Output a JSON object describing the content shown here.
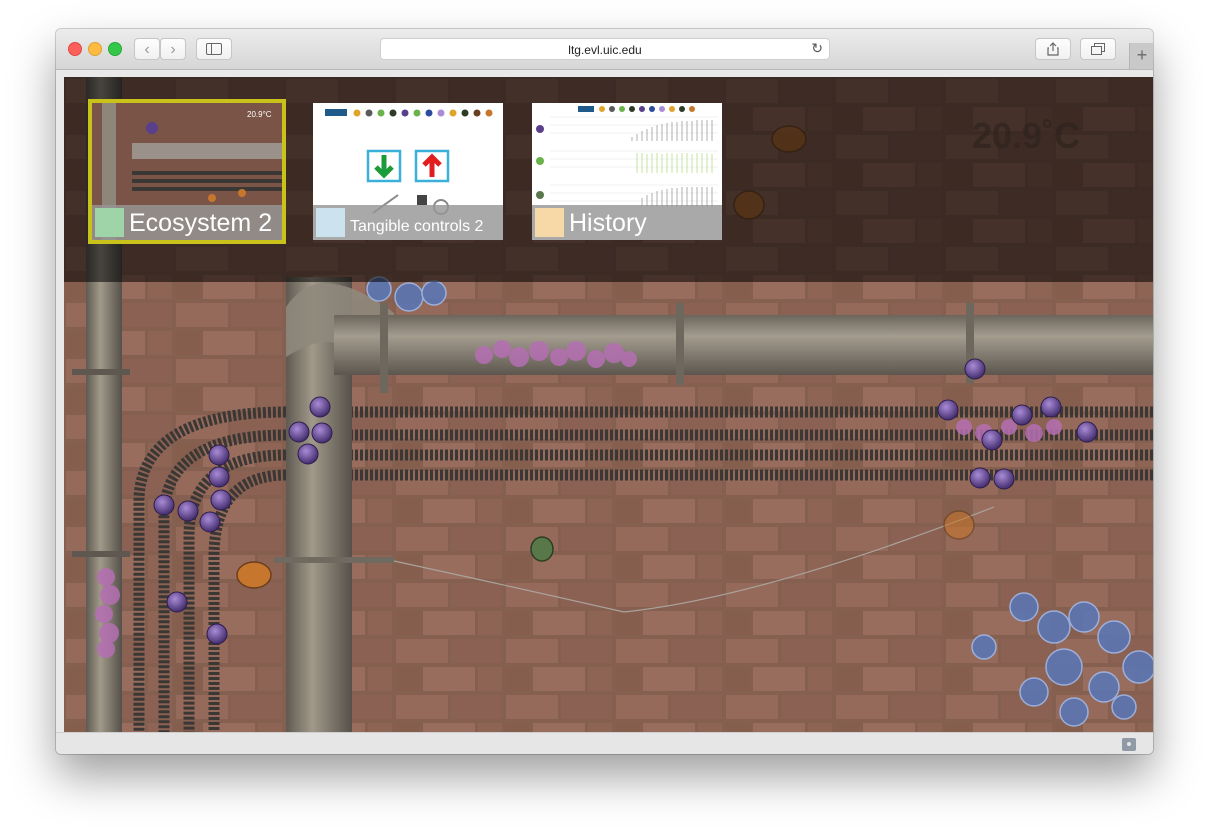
{
  "browser": {
    "url": "ltg.evl.uic.edu",
    "back_icon": "‹",
    "forward_icon": "›",
    "reload_icon": "↻",
    "new_tab_icon": "+"
  },
  "overlay": {
    "temperature": "20.9˚C",
    "thumbnails": [
      {
        "label": "Ecosystem 2",
        "swatch": "#9ed4a8",
        "selected": true,
        "inner_temp": "20.9°C"
      },
      {
        "label": "Tangible controls 2",
        "swatch": "#cde2ef",
        "selected": false
      },
      {
        "label": "History",
        "swatch": "#f7d9a8",
        "selected": false
      }
    ]
  },
  "colors": {
    "highlight": "#c9c21b",
    "brick": "#8a5c4c",
    "pipe": "#8e877b"
  }
}
